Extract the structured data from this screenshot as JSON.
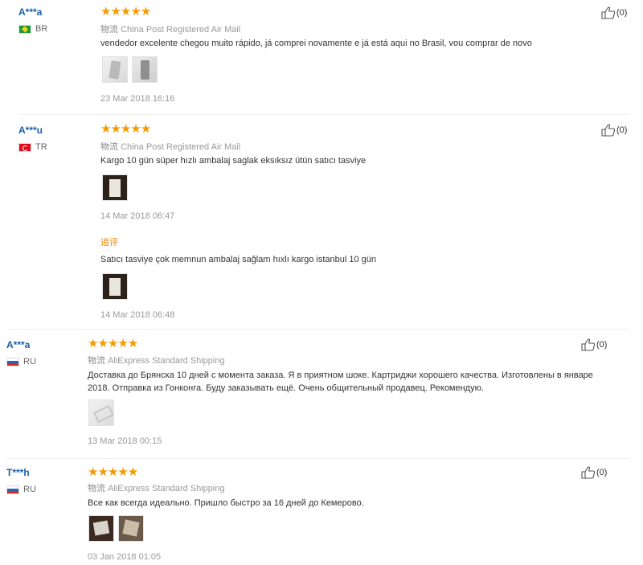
{
  "reviews": [
    {
      "user": "A***a",
      "country": "BR",
      "stars": "★★★★★",
      "rating": 5,
      "logistics_label": "物流",
      "logistics_method": "China Post Registered Air Mail",
      "text": "vendedor excelente chegou muito rápido, já comprei novamente e já está aqui no Brasil, vou comprar de novo",
      "date": "23 Mar 2018 16:16",
      "likes": "(0)"
    },
    {
      "user": "A***u",
      "country": "TR",
      "stars": "★★★★★",
      "rating": 5,
      "logistics_label": "物流",
      "logistics_method": "China Post Registered Air Mail",
      "text": "Kargo 10 gün süper hızlı ambalaj saglak eksıksız ütün satıcı tasviye",
      "date": "14 Mar 2018 06:47",
      "likes": "(0)",
      "additional": {
        "label": "追评",
        "text": "Satıcı tasviye çok memnun ambalaj sağlam hıxlı kargo istanbul 10 gün",
        "date": "14 Mar 2018 06:48"
      }
    },
    {
      "user": "A***a",
      "country": "RU",
      "stars": "★★★★★",
      "rating": 5,
      "logistics_label": "物流",
      "logistics_method": "AliExpress Standard Shipping",
      "text": "Доставка до Брянска 10 дней с момента заказа. Я в приятном шоке. Картриджи хорошего качества. Изготовлены в январе 2018. Отправка из Гонконга. Буду заказывать ещё. Очень общительный продавец. Рекомендую.",
      "date": "13 Mar 2018 00:15",
      "likes": "(0)"
    },
    {
      "user": "T***h",
      "country": "RU",
      "stars": "★★★★★",
      "rating": 5,
      "logistics_label": "物流",
      "logistics_method": "AliExpress Standard Shipping",
      "text": "Все как всегда идеально. Пришло быстро за 16 дней до Кемерово.",
      "date": "03 Jan 2018 01:05",
      "likes": "(0)"
    }
  ],
  "colors": {
    "star": "#f59a00",
    "username": "#1a5ea8",
    "additional_label": "#f08200",
    "muted": "#999999"
  }
}
